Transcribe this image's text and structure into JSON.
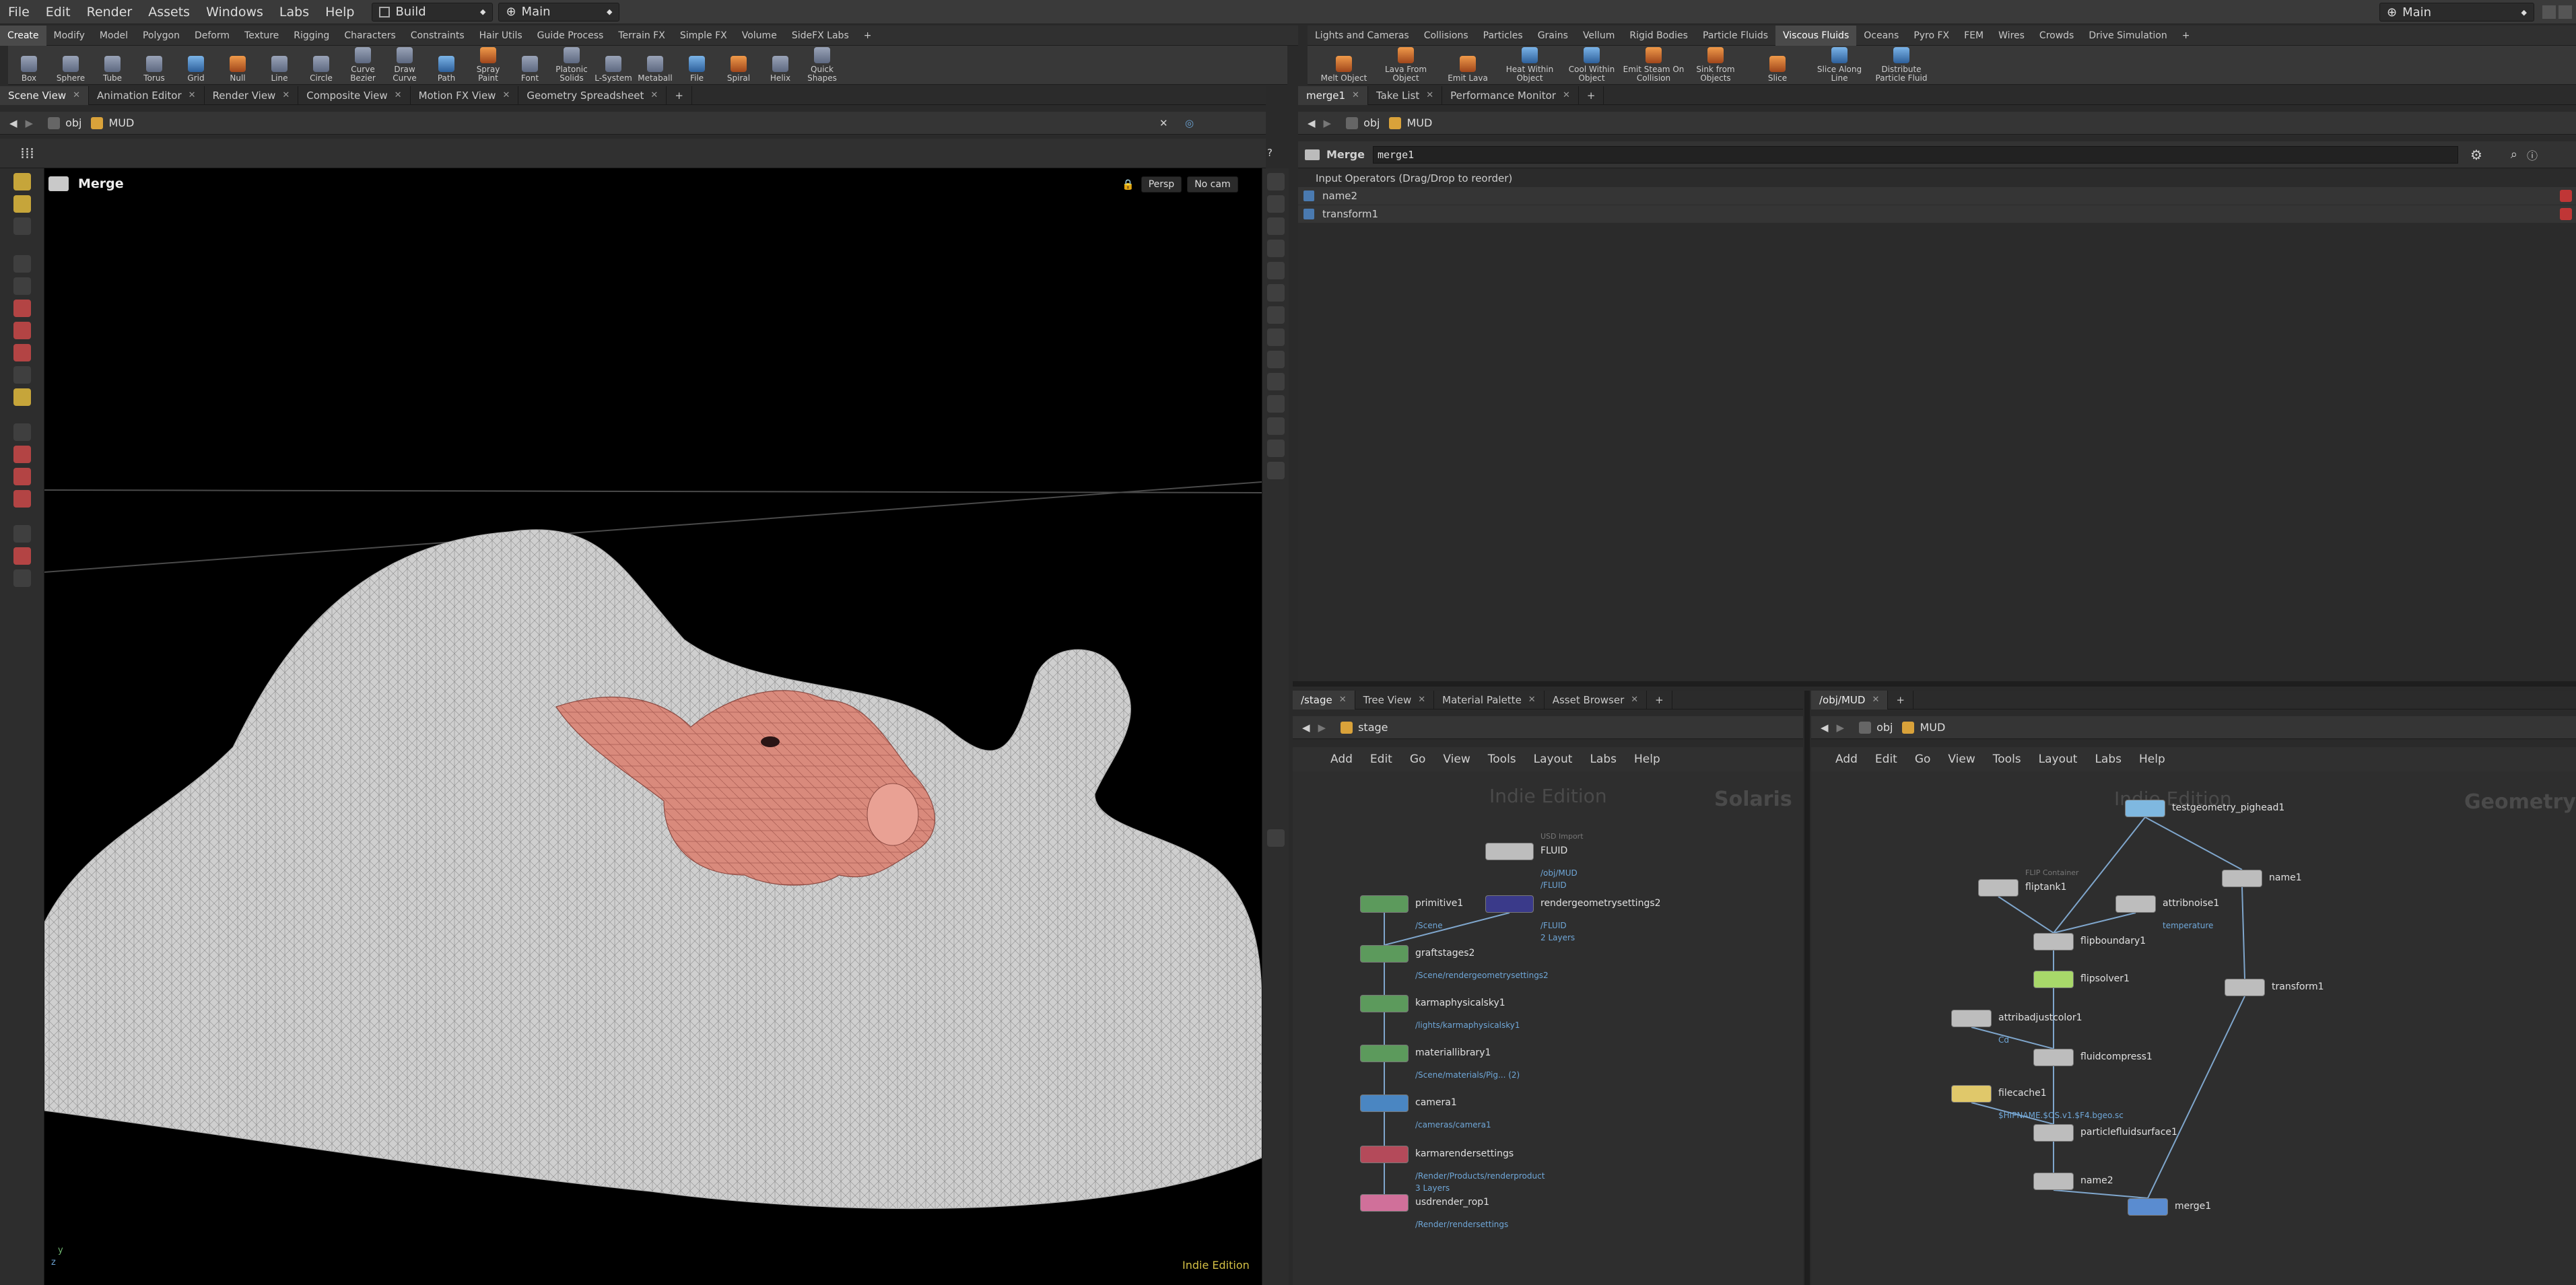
{
  "menubar": {
    "items": [
      "File",
      "Edit",
      "Render",
      "Assets",
      "Windows",
      "Labs",
      "Help"
    ],
    "desktop": "Build",
    "context": "Main",
    "right_context": "Main"
  },
  "shelf_left": {
    "tabs": [
      "Create",
      "Modify",
      "Model",
      "Polygon",
      "Deform",
      "Texture",
      "Rigging",
      "Characters",
      "Constraints",
      "Hair Utils",
      "Guide Process",
      "Terrain FX",
      "Simple FX",
      "Volume",
      "SideFX Labs"
    ],
    "active_tab": "Create",
    "tools": [
      "Box",
      "Sphere",
      "Tube",
      "Torus",
      "Grid",
      "Null",
      "Line",
      "Circle",
      "Curve Bezier",
      "Draw Curve",
      "Path",
      "Spray Paint",
      "Font",
      "Platonic Solids",
      "L-System",
      "Metaball",
      "File",
      "Spiral",
      "Helix",
      "Quick Shapes"
    ]
  },
  "shelf_right": {
    "tabs": [
      "Lights and Cameras",
      "Collisions",
      "Particles",
      "Grains",
      "Vellum",
      "Rigid Bodies",
      "Particle Fluids",
      "Viscous Fluids",
      "Oceans",
      "Pyro FX",
      "FEM",
      "Wires",
      "Crowds",
      "Drive Simulation"
    ],
    "active_tab": "Viscous Fluids",
    "tools": [
      "Melt Object",
      "Lava From Object",
      "Emit Lava",
      "Heat Within Object",
      "Cool Within Object",
      "Emit Steam On Collision",
      "Sink from Objects",
      "Slice",
      "Slice Along Line",
      "Distribute Particle Fluid"
    ]
  },
  "viewport": {
    "tabs": [
      "Scene View",
      "Animation Editor",
      "Render View",
      "Composite View",
      "Motion FX View",
      "Geometry Spreadsheet"
    ],
    "path": [
      "obj",
      "MUD"
    ],
    "title": "Merge",
    "persp": "Persp",
    "cam": "No cam",
    "edition": "Indie Edition",
    "axis_y": "y",
    "axis_z": "z"
  },
  "params": {
    "tabs": [
      "merge1",
      "Take List",
      "Performance Monitor"
    ],
    "path": [
      "obj",
      "MUD"
    ],
    "node_type": "Merge",
    "node_name": "merge1",
    "input_header": "Input Operators (Drag/Drop to reorder)",
    "inputs": [
      "name2",
      "transform1"
    ]
  },
  "stage_pane": {
    "tabs": [
      "/stage",
      "Tree View",
      "Material Palette",
      "Asset Browser"
    ],
    "path": [
      "stage"
    ],
    "menu": [
      "Add",
      "Edit",
      "Go",
      "View",
      "Tools",
      "Layout",
      "Labs",
      "Help"
    ],
    "watermark_left": "Indie Edition",
    "watermark_right": "Solaris",
    "nodes": [
      {
        "name": "FLUID",
        "label": "USD Import",
        "subs": [
          "/obj/MUD",
          "/FLUID"
        ]
      },
      {
        "name": "primitive1",
        "subs": [
          "/Scene"
        ]
      },
      {
        "name": "rendergeometrysettings2",
        "subs": [
          "/FLUID",
          "2 Layers"
        ]
      },
      {
        "name": "graftstages2",
        "subs": [
          "/Scene/rendergeometrysettings2"
        ]
      },
      {
        "name": "karmaphysicalsky1",
        "subs": [
          "/lights/karmaphysicalsky1"
        ]
      },
      {
        "name": "materiallibrary1",
        "subs": [
          "/Scene/materials/Pig...  (2)"
        ]
      },
      {
        "name": "camera1",
        "subs": [
          "/cameras/camera1"
        ]
      },
      {
        "name": "karmarendersettings",
        "subs": [
          "/Render/Products/renderproduct",
          "3 Layers"
        ]
      },
      {
        "name": "usdrender_rop1",
        "subs": [
          "/Render/rendersettings"
        ]
      }
    ]
  },
  "obj_pane": {
    "tabs": [
      "/obj/MUD"
    ],
    "path": [
      "obj",
      "MUD"
    ],
    "menu": [
      "Add",
      "Edit",
      "Go",
      "View",
      "Tools",
      "Layout",
      "Labs",
      "Help"
    ],
    "watermark_left": "Indie Edition",
    "watermark_right": "Geometry",
    "nodes": [
      {
        "name": "testgeometry_pighead1",
        "subs": []
      },
      {
        "name": "fliptank1",
        "label": "FLIP Container",
        "subs": []
      },
      {
        "name": "attribnoise1",
        "subs": [
          "temperature"
        ]
      },
      {
        "name": "name1",
        "subs": []
      },
      {
        "name": "flipboundary1",
        "subs": []
      },
      {
        "name": "flipsolver1",
        "subs": []
      },
      {
        "name": "transform1",
        "subs": []
      },
      {
        "name": "attribadjustcolor1",
        "subs": [
          "Cd"
        ]
      },
      {
        "name": "fluidcompress1",
        "subs": []
      },
      {
        "name": "filecache1",
        "subs": [
          "$HIPNAME.$OS.v1.$F4.bgeo.sc"
        ]
      },
      {
        "name": "particlefluidsurface1",
        "subs": []
      },
      {
        "name": "name2",
        "subs": []
      },
      {
        "name": "merge1",
        "subs": []
      }
    ]
  },
  "colors": {
    "accent": "#4b6f9a",
    "viewport_bg": "#000000",
    "mud": "#c9c9c9",
    "pig": "#d98a7c"
  }
}
